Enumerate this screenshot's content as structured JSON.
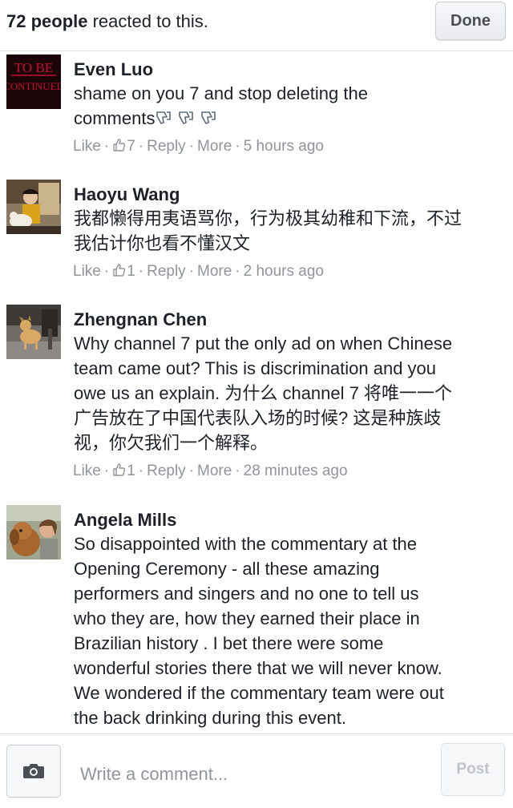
{
  "header": {
    "count": "72 people",
    "reacted_text": " reacted to this.",
    "done_label": "Done"
  },
  "comments": [
    {
      "name": "Even Luo",
      "avatar_icon": "to-be-continued-avatar",
      "avatar_text_1": "TO BE",
      "avatar_text_2": "CONTINUED",
      "lines": [
        "shame on you 7 and stop deleting the",
        "comments"
      ],
      "like": "Like",
      "like_count": "7",
      "reply": "Reply",
      "more": "More",
      "time": "5 hours ago"
    },
    {
      "name": "Haoyu Wang",
      "avatar_icon": "person-with-dog-avatar",
      "lines": [
        "我都懒得用夷语骂你，行为极其幼稚和下流，不过",
        "我估计你也看不懂汉文"
      ],
      "like": "Like",
      "like_count": "1",
      "reply": "Reply",
      "more": "More",
      "time": "2 hours ago"
    },
    {
      "name": "Zhengnan Chen",
      "avatar_icon": "dog-on-street-avatar",
      "lines": [
        "Why channel 7 put the only ad on when Chinese",
        "team came out? This is discrimination and you",
        "owe us an explain. 为什么 channel 7 将唯一一个",
        "广告放在了中国代表队入场的时候? 这是种族歧",
        "视，你欠我们一个解释。"
      ],
      "like": "Like",
      "like_count": "1",
      "reply": "Reply",
      "more": "More",
      "time": "28 minutes ago"
    },
    {
      "name": "Angela Mills",
      "avatar_icon": "woman-with-dog-avatar",
      "lines": [
        "So disappointed with the commentary at the",
        "Opening Ceremony - all these amazing",
        "performers and singers and no one to tell us",
        "who they are, how they earned their place in",
        "Brazilian history . I bet there were some",
        "wonderful stories there that we will never know.",
        "We wondered if the commentary team were out",
        "the back drinking during this event."
      ]
    }
  ],
  "footer": {
    "camera_icon": "camera-icon",
    "placeholder": "Write a comment...",
    "post_label": "Post"
  },
  "colors": {
    "text": "#1d2129",
    "meta": "#90949c",
    "divider": "#dcdee3"
  }
}
